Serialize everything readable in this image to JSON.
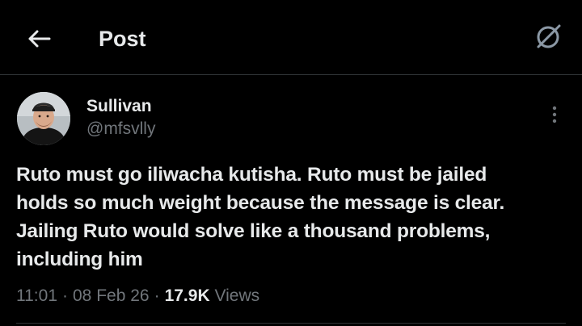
{
  "header": {
    "title": "Post",
    "back_icon": "arrow-left-icon",
    "grok_icon": "grok-icon"
  },
  "author": {
    "name": "Sullivan",
    "handle": "@mfsvlly",
    "avatar_icon": "avatar-photo"
  },
  "post": {
    "text": "Ruto must go iliwacha kutisha. Ruto must be jailed\nholds so much weight because the message is clear.\nJailing Ruto would solve like a thousand problems,\nincluding him",
    "time": "11:01",
    "date": "08 Feb 26",
    "views_count": "17.9K",
    "views_label": "Views",
    "more_icon": "more-vertical-icon"
  },
  "colors": {
    "background": "#000000",
    "primary_text": "#e7e9ea",
    "secondary_text": "#71767b",
    "divider": "#2f3336"
  }
}
